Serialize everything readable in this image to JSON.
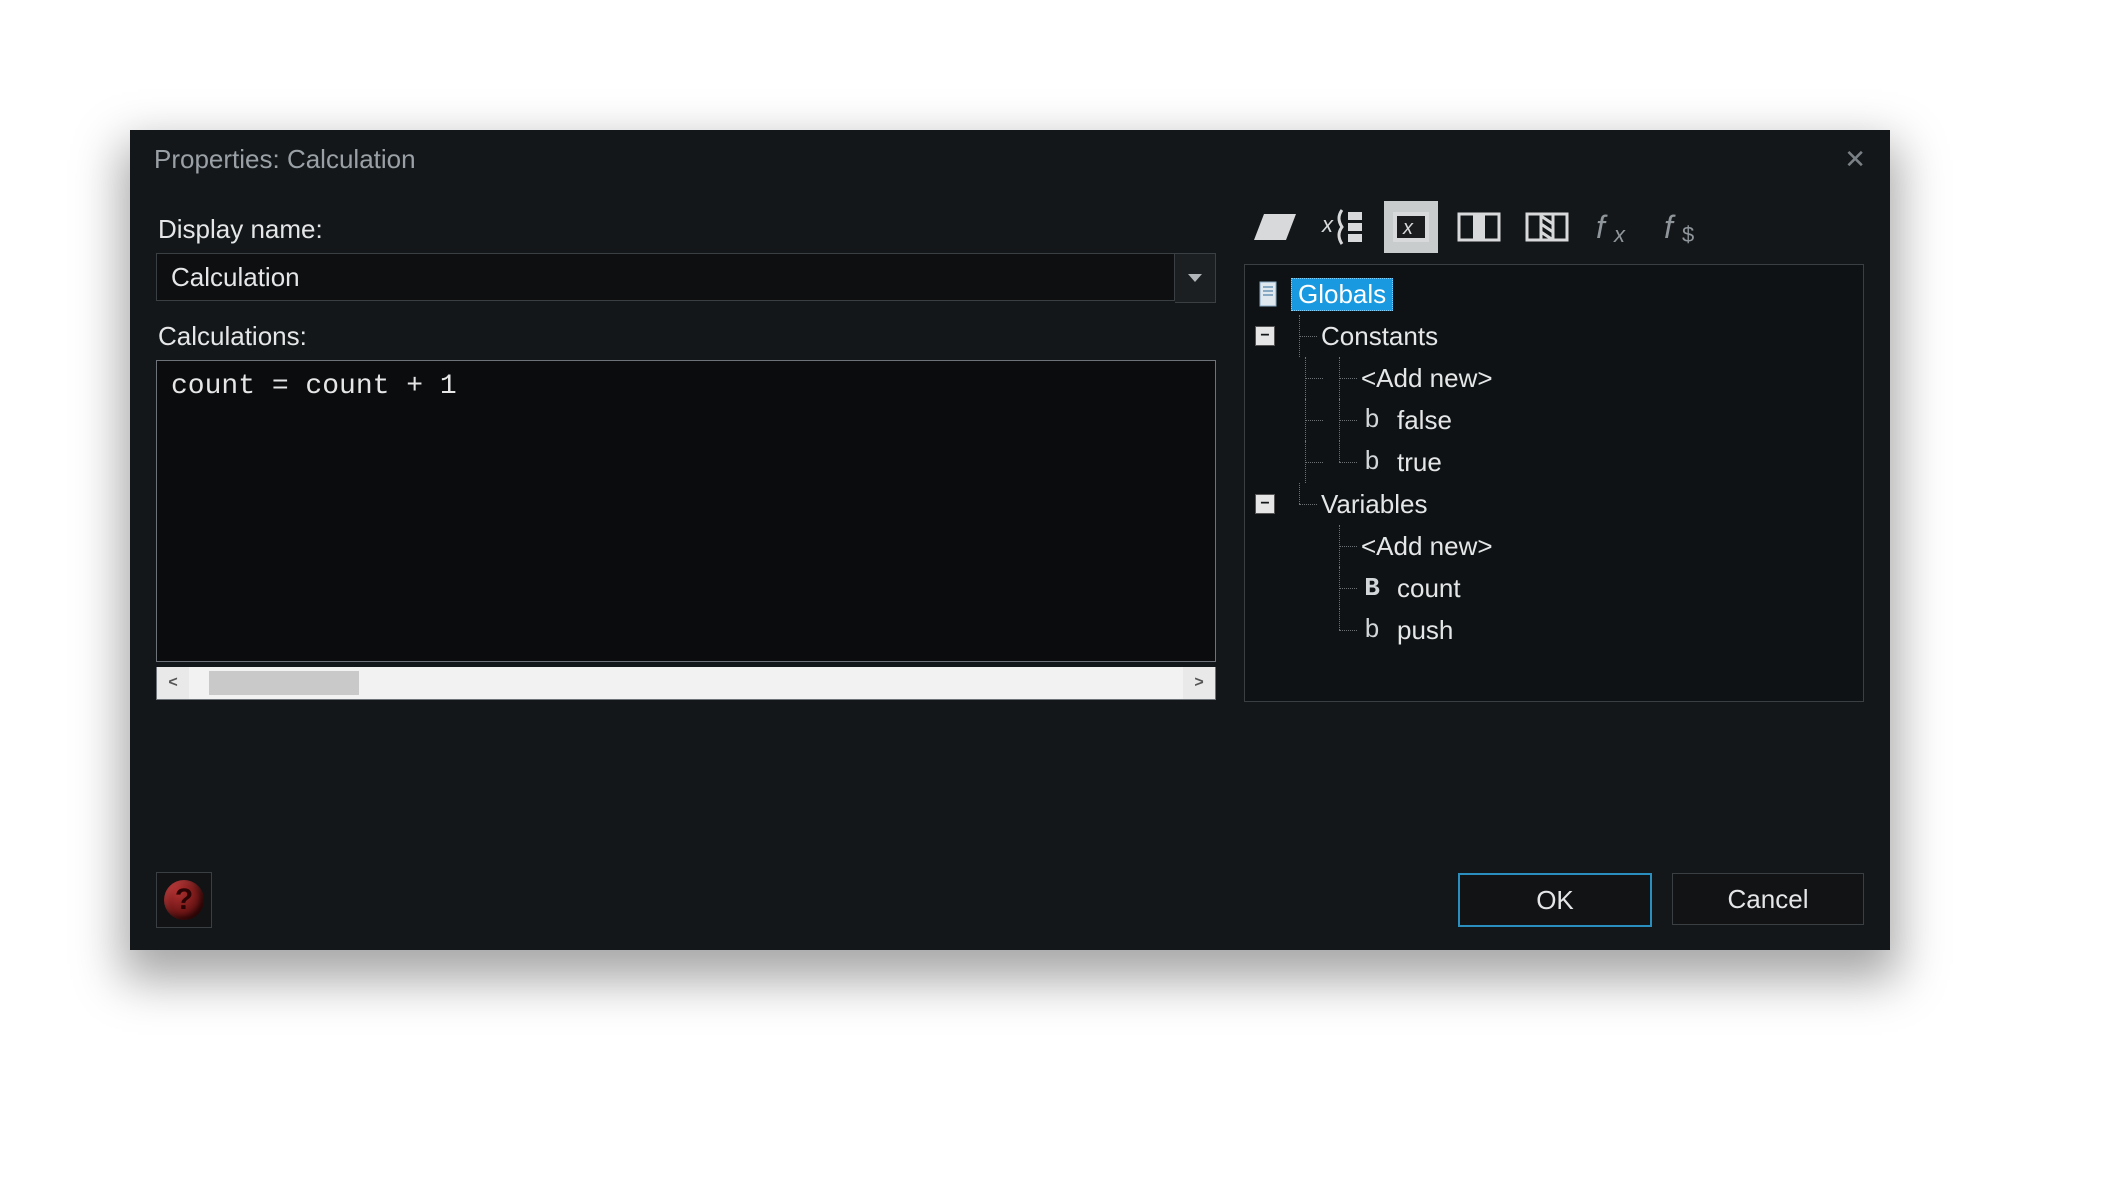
{
  "dialog": {
    "title": "Properties: Calculation",
    "display_name_label": "Display name:",
    "display_name_value": "Calculation",
    "calculations_label": "Calculations:",
    "calculations_code": "count = count + 1",
    "ok_label": "OK",
    "cancel_label": "Cancel",
    "help_glyph": "?"
  },
  "toolbar": {
    "icons": [
      "data-set",
      "group",
      "variable",
      "column-left",
      "column-hatched",
      "fx",
      "f-dollar"
    ]
  },
  "tree": {
    "root": "Globals",
    "groups": [
      {
        "label": "Constants",
        "add_new": "<Add new>",
        "items": [
          {
            "label": "false",
            "type_glyph": "b"
          },
          {
            "label": "true",
            "type_glyph": "b"
          }
        ]
      },
      {
        "label": "Variables",
        "add_new": "<Add new>",
        "items": [
          {
            "label": "count",
            "type_glyph": "B"
          },
          {
            "label": "push",
            "type_glyph": "b"
          }
        ]
      }
    ]
  }
}
